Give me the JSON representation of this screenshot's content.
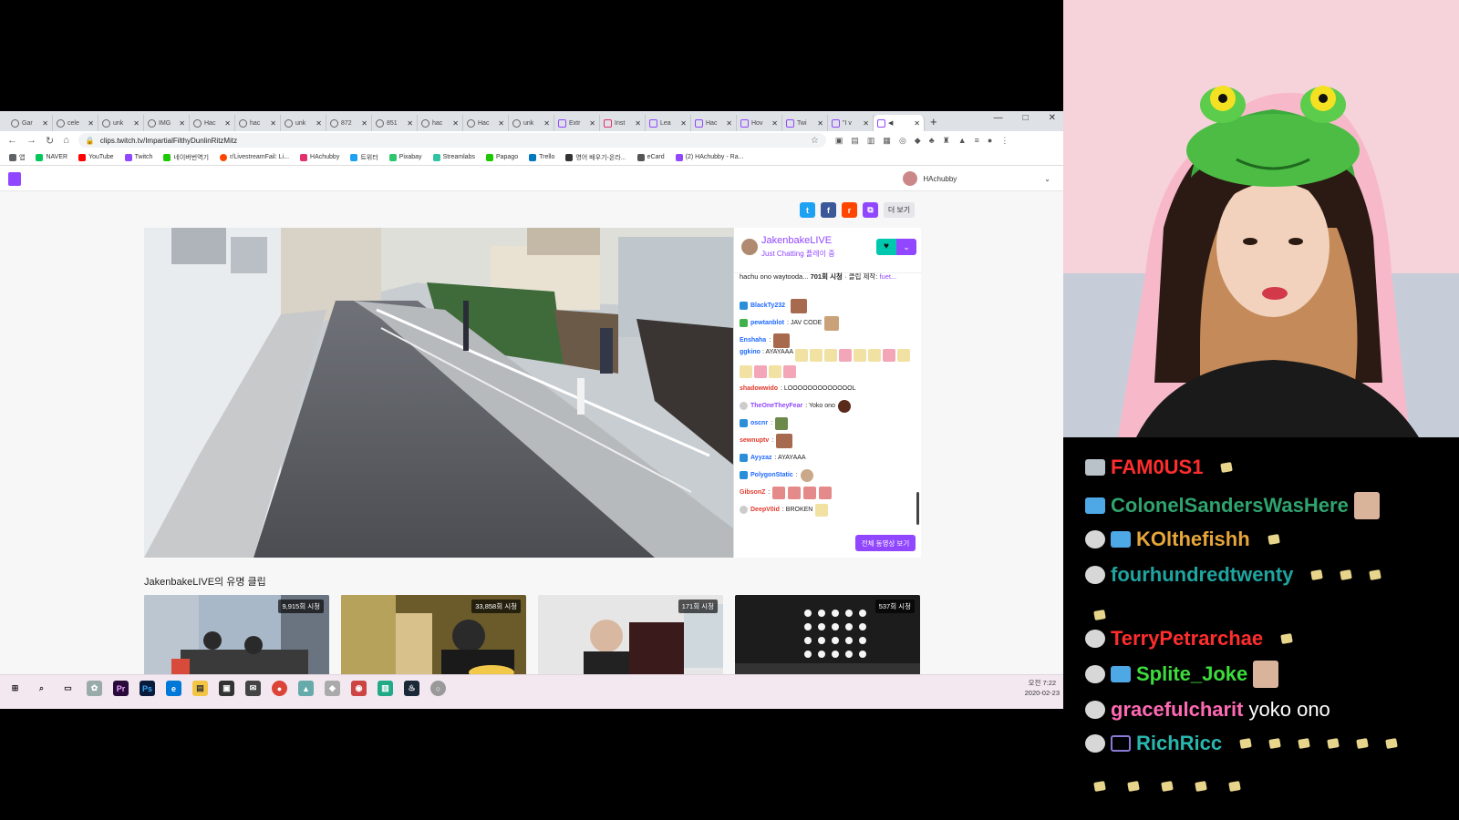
{
  "browser": {
    "tabs": [
      "Gar",
      "cele",
      "unk",
      "IMG",
      "Hac",
      "hac",
      "unk",
      "872",
      "851",
      "hac",
      "Hac",
      "unk",
      "Extr",
      "Inst",
      "Lea",
      "Hac",
      "Hov",
      "Twi",
      "\"I v",
      "◀"
    ],
    "url": "clips.twitch.tv/ImpartialFilthyDunlinRitzMitz",
    "bookmarks": [
      "앱",
      "NAVER",
      "YouTube",
      "Twitch",
      "네이버번역기",
      "r/LivestreamFail: Li...",
      "HAchubby",
      "트위터",
      "Pixabay",
      "Streamlabs",
      "Papago",
      "Trello",
      "영어 배우기-온라...",
      "eCard",
      "(2) HAchubby - Ra..."
    ],
    "window_controls": [
      "—",
      "□",
      "✕"
    ]
  },
  "twitch": {
    "username": "HAchubby",
    "share_more": "더 보기",
    "channel": "JakenbakeLIVE",
    "game_line": "Just Chatting 플레이 중",
    "clip_title": "hachu ono waytooda...",
    "clip_views": "701회 시청",
    "clip_by_label": "· 클립 제작:",
    "clip_by_user": "fuet...",
    "watch_all": "전체 동영상 보기",
    "popular_title": "JakenbakeLIVE의 유명 클립",
    "thumb_views": [
      "9,915회 시청",
      "33,858회 시청",
      "171회 시청",
      "537회 시청"
    ],
    "chat": [
      {
        "user": "BlackTy232",
        "color": "#1e69ff",
        "text": ""
      },
      {
        "user": "pewtanblot",
        "color": "#1e69ff",
        "text": ": JAV CODE"
      },
      {
        "user": "Enshaha",
        "color": "#1e69ff",
        "text": ":"
      },
      {
        "user": "ggkino",
        "color": "#1e69ff",
        "text": ": AYAYAAA"
      },
      {
        "user": "shadowwido",
        "color": "#e0392b",
        "text": ": LOOOOOOOOOOOOOL"
      },
      {
        "user": "TheOneTheyFear",
        "color": "#9147ff",
        "text": ": Yoko ono"
      },
      {
        "user": "oscnr",
        "color": "#1e69ff",
        "text": ":"
      },
      {
        "user": "sewnuptv",
        "color": "#e0392b",
        "text": ":"
      },
      {
        "user": "Ayyzaz",
        "color": "#1e69ff",
        "text": ": AYAYAAA"
      },
      {
        "user": "PolygonStatic",
        "color": "#1e69ff",
        "text": ":"
      },
      {
        "user": "GibsonZ",
        "color": "#e0392b",
        "text": ":"
      },
      {
        "user": "DeepV0id",
        "color": "#e0392b",
        "text": ": BROKEN"
      }
    ]
  },
  "taskbar": {
    "time": "오전 7:22",
    "date": "2020-02-23"
  },
  "overlay": [
    {
      "user": "FAM0US1",
      "color": "#ff2d2d",
      "msg": ""
    },
    {
      "user": "ColonelSandersWasHere",
      "color": "#2fa36e",
      "msg": ""
    },
    {
      "user": "KOlthefishh",
      "color": "#e6a63a",
      "msg": ""
    },
    {
      "user": "fourhundredtwenty",
      "color": "#1fa5a0",
      "msg": ""
    },
    {
      "user": "TerryPetrarchae",
      "color": "#ff2d2d",
      "msg": ""
    },
    {
      "user": "Splite_Joke",
      "color": "#3cdc3c",
      "msg": ""
    },
    {
      "user": "gracefulcharit",
      "color": "#ff69b4",
      "msg": "yoko ono"
    },
    {
      "user": "RichRicc",
      "color": "#2ab5ad",
      "msg": ""
    }
  ],
  "colors": {
    "twitch_purple": "#9147ff",
    "follow_teal": "#00c8af"
  }
}
